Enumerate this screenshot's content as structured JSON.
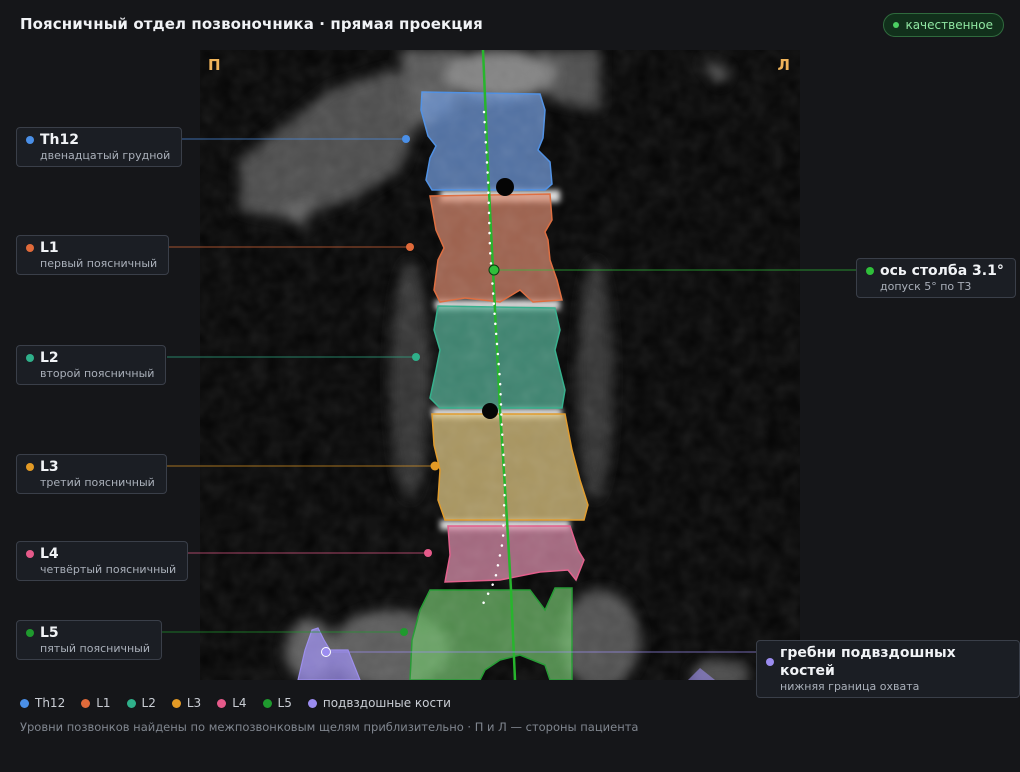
{
  "header": {
    "title": "Поясничный отдел позвоночника · прямая проекция",
    "badge": "качественное"
  },
  "image": {
    "right_side_label": "П",
    "left_side_label": "Л"
  },
  "vertebrae": [
    {
      "id": "th12",
      "name": "Th12",
      "sub": "двенадцатый грудной",
      "color": "#4a8fe7"
    },
    {
      "id": "l1",
      "name": "L1",
      "sub": "первый поясничный",
      "color": "#e06a3a"
    },
    {
      "id": "l2",
      "name": "L2",
      "sub": "второй поясничный",
      "color": "#2fb08a"
    },
    {
      "id": "l3",
      "name": "L3",
      "sub": "третий поясничный",
      "color": "#e39a25"
    },
    {
      "id": "l4",
      "name": "L4",
      "sub": "четвёртый поясничный",
      "color": "#e65a8a"
    },
    {
      "id": "l5",
      "name": "L5",
      "sub": "пятый поясничный",
      "color": "#1f9a2e"
    }
  ],
  "axis_callout": {
    "title": "ось столба 3.1°",
    "sub": "допуск 5° по Т3",
    "color": "#2fbf3a"
  },
  "iliac_callout": {
    "title": "гребни подвздошных костей",
    "sub": "нижняя граница охвата",
    "color": "#9b8cf0"
  },
  "legend": [
    {
      "label": "Th12",
      "color": "#4a8fe7"
    },
    {
      "label": "L1",
      "color": "#e06a3a"
    },
    {
      "label": "L2",
      "color": "#2fb08a"
    },
    {
      "label": "L3",
      "color": "#e39a25"
    },
    {
      "label": "L4",
      "color": "#e65a8a"
    },
    {
      "label": "L5",
      "color": "#1f9a2e"
    },
    {
      "label": "подвздошные кости",
      "color": "#9b8cf0"
    }
  ],
  "note": "Уровни позвонков найдены по межпозвонковым щелям приблизительно · П и Л — стороны пациента"
}
